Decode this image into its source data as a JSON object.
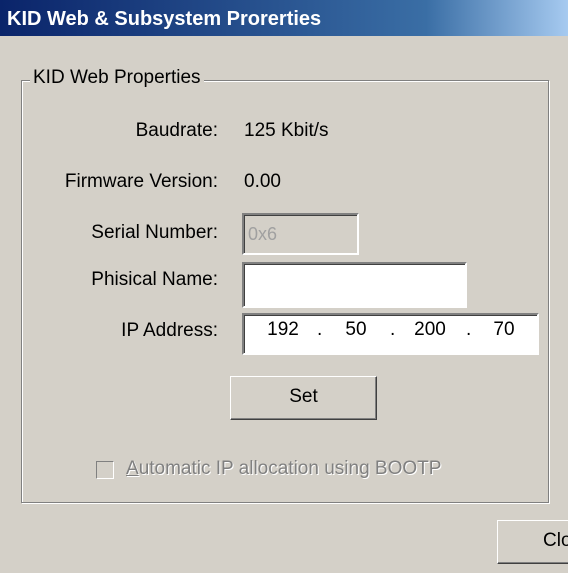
{
  "window": {
    "title": "KID Web & Subsystem Prorerties"
  },
  "group": {
    "legend": "KID Web Properties",
    "baudrate": {
      "label": "Baudrate:",
      "value": "125 Kbit/s"
    },
    "firmware": {
      "label": "Firmware Version:",
      "value": "0.00"
    },
    "serial": {
      "label": "Serial Number:",
      "value": "0x6"
    },
    "physical_name": {
      "label": "Phisical Name:",
      "value": ""
    },
    "ip": {
      "label": "IP Address:",
      "octets": [
        "192",
        "50",
        "200",
        "70"
      ],
      "separator": "."
    },
    "set_button": "Set",
    "bootp": {
      "mnemonic": "A",
      "label_rest": "utomatic IP allocation using BOOTP",
      "checked": false,
      "enabled": false
    }
  },
  "close_button": "Clo"
}
